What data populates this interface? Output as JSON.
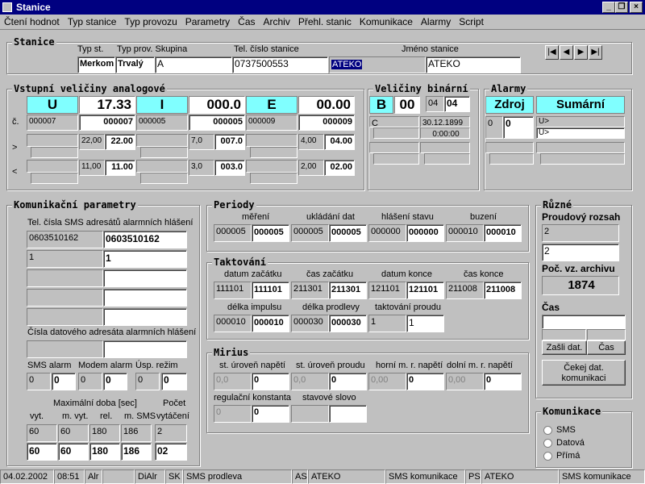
{
  "window": {
    "title": "Stanice"
  },
  "menu": [
    "Čtení hodnot",
    "Typ stanice",
    "Typ provozu",
    "Parametry",
    "Čas",
    "Archiv",
    "Přehl. stanic",
    "Komunikace",
    "Alarmy",
    "Script"
  ],
  "stanice": {
    "title": "Stanice",
    "h_typ": "Typ st.",
    "h_prov": "Typ prov. Skupina",
    "h_tel": "Tel. číslo stanice",
    "h_jmeno": "Jméno stanice",
    "typ": "Merkom",
    "prov": "Trvalý",
    "skupina": "A",
    "tel": "0737500553",
    "jmeno_sel": "ATEKO",
    "jmeno": "ATEKO"
  },
  "analog": {
    "title": "Vstupní veličiny analogové",
    "row_c": "č.",
    "row_gt": ">",
    "row_lt": "<",
    "cols": [
      {
        "name": "U",
        "big": "17.33",
        "code": "000007",
        "codev": "000007",
        "gt_a": "22,00",
        "gt_b": "22.00",
        "lt_a": "11,00",
        "lt_b": "11.00"
      },
      {
        "name": "I",
        "big": "000.0",
        "code": "000005",
        "codev": "000005",
        "gt_a": "7,0",
        "gt_b": "007.0",
        "lt_a": "3,0",
        "lt_b": "003.0"
      },
      {
        "name": "E",
        "big": "00.00",
        "code": "000009",
        "codev": "000009",
        "gt_a": "4,00",
        "gt_b": "04.00",
        "lt_a": "2,00",
        "lt_b": "02.00"
      }
    ]
  },
  "binar": {
    "title": "Veličiny binární",
    "name": "B",
    "val": "00",
    "a": "04",
    "b": "04",
    "c": "C",
    "date": "30.12.1899",
    "time": "0:00:00"
  },
  "alarmy": {
    "title": "Alarmy",
    "zdroj": "Zdroj",
    "sumarni": "Sumární",
    "v0": "0",
    "v1": "0",
    "u1": "U>",
    "u2": "U>"
  },
  "komunikacni": {
    "title": "Komunikační parametry",
    "tel_hdr": "Tel. čísla SMS adresátů alarmních hlášení",
    "tels": [
      [
        "0603510162",
        "0603510162"
      ],
      [
        "1",
        "1"
      ],
      [
        "",
        ""
      ],
      [
        "",
        ""
      ],
      [
        "",
        ""
      ]
    ],
    "dat_hdr": "Čísla datového adresáta alarmních hlášení",
    "sms_alarm": "SMS alarm",
    "modem_alarm": "Modem alarm",
    "usp_rezim": "Úsp. režim",
    "sms_a": "0",
    "sms_b": "0",
    "mod_a": "0",
    "mod_b": "0",
    "usp_a": "0",
    "usp_b": "0",
    "max_doba": "Maximální doba [sec]",
    "pocet": "Počet",
    "h_vyt": "vyt.",
    "h_mvyt": "m. vyt.",
    "h_rel": "rel.",
    "h_msms": "m. SMS",
    "h_vytaceni": "vytáčení",
    "r1": [
      "60",
      "60",
      "180",
      "186",
      "2"
    ],
    "r2": [
      "60",
      "60",
      "180",
      "186",
      "02"
    ]
  },
  "periody": {
    "title": "Periody",
    "h": [
      "měření",
      "ukládání dat",
      "hlášení stavu",
      "buzení"
    ],
    "vals": [
      [
        "000005",
        "000005"
      ],
      [
        "000005",
        "000005"
      ],
      [
        "000000",
        "000000"
      ],
      [
        "000010",
        "000010"
      ]
    ]
  },
  "taktovani": {
    "title": "Taktování",
    "h": [
      "datum začátku",
      "čas začátku",
      "datum konce",
      "čas konce"
    ],
    "vals": [
      [
        "111101",
        "111101"
      ],
      [
        "211301",
        "211301"
      ],
      [
        "121101",
        "121101"
      ],
      [
        "211008",
        "211008"
      ]
    ],
    "h2": [
      "délka impulsu",
      "délka prodlevy",
      "taktování proudu"
    ],
    "vals2": [
      [
        "000010",
        "000010"
      ],
      [
        "000030",
        "000030"
      ],
      [
        "1",
        "1"
      ]
    ]
  },
  "mirius": {
    "title": "Mirius",
    "h": [
      "st. úroveň napětí",
      "st. úroveň proudu",
      "horní m. r. napětí",
      "dolní m. r. napětí"
    ],
    "vals": [
      [
        "0,0",
        "0"
      ],
      [
        "0,0",
        "0"
      ],
      [
        "0,00",
        "0"
      ],
      [
        "0,00",
        "0"
      ]
    ],
    "h2": [
      "regulační konstanta",
      "stavové slovo"
    ],
    "reg": [
      "0",
      "0"
    ]
  },
  "ruzne": {
    "title": "Různé",
    "proud": "Proudový rozsah",
    "pa": "2",
    "pb": "2",
    "poc": "Poč. vz. archivu",
    "pocv": "1874",
    "cas": "Čas",
    "btn1": "Zašli dat.",
    "btn2": "Čas",
    "btn3": "Čekej dat. komunikaci"
  },
  "kom": {
    "title": "Komunikace",
    "opts": [
      "SMS",
      "Datová",
      "Přímá"
    ]
  },
  "status": [
    "04.02.2002",
    "08:51",
    "Alr",
    "",
    "DiAlr",
    "SK",
    "SMS prodleva",
    "AS",
    "ATEKO",
    "SMS komunikace",
    "PS",
    "ATEKO",
    "SMS komunikace"
  ]
}
